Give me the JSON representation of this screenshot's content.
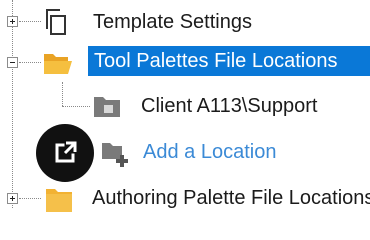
{
  "tree": {
    "items": [
      {
        "label": "Template Settings",
        "expand": "+",
        "icon": "copy-document-icon"
      },
      {
        "label": "Tool Palettes File Locations",
        "expand": "-",
        "icon": "open-folder-icon",
        "selected": true
      },
      {
        "label": "Client A113\\Support",
        "icon": "folder-gray-icon"
      },
      {
        "label": "Add a Location",
        "icon": "add-folder-icon"
      },
      {
        "label": "Authoring Palette File Locations",
        "expand": "+",
        "icon": "folder-icon"
      }
    ]
  },
  "overlay": {
    "icon": "external-link-icon"
  },
  "colors": {
    "selection": "#0a78d7",
    "link": "#3b8ad6",
    "folder": "#f2b233"
  }
}
